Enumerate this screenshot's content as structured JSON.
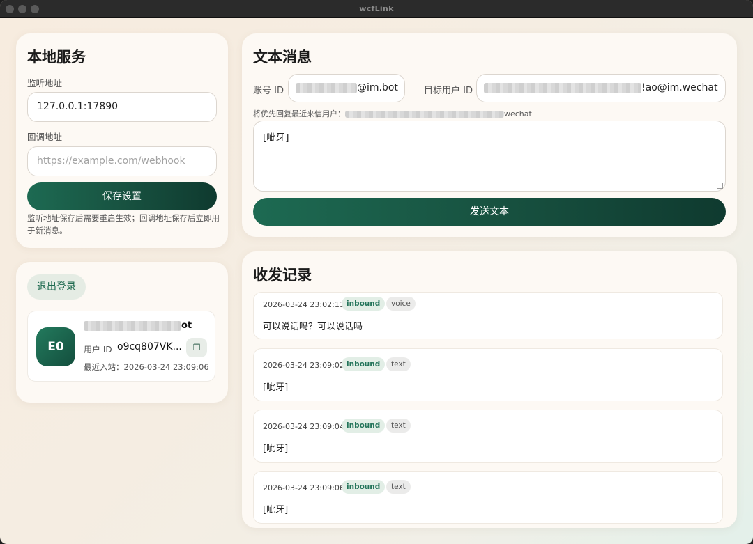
{
  "window": {
    "title": "wcfLink"
  },
  "local_service": {
    "title": "本地服务",
    "listen_label": "监听地址",
    "listen_value": "127.0.0.1:17890",
    "callback_label": "回调地址",
    "callback_placeholder": "https://example.com/webhook",
    "save_button": "保存设置",
    "note": "监听地址保存后需要重启生效；回调地址保存后立即用于新消息。"
  },
  "account": {
    "logout_button": "退出登录",
    "avatar_text": "E0",
    "name_suffix": "ot",
    "user_id_label": "用户 ID",
    "user_id_value": "o9cq807VK...",
    "last_inbound_label": "最近入站：",
    "last_inbound_value": "2026-03-24 23:09:06"
  },
  "text_message": {
    "title": "文本消息",
    "account_id_label": "账号 ID",
    "account_id_suffix": "@im.bot",
    "target_user_label": "目标用户 ID",
    "target_user_suffix": "!ao@im.wechat",
    "hint_prefix": "将优先回复最近来信用户：",
    "hint_suffix": "wechat",
    "message_value": "[呲牙]",
    "send_button": "发送文本"
  },
  "records": {
    "title": "收发记录",
    "items": [
      {
        "time": "2026-03-24 23:02:11",
        "direction": "inbound",
        "kind": "voice",
        "text": "可以说话吗？可以说话吗"
      },
      {
        "time": "2026-03-24 23:09:02",
        "direction": "inbound",
        "kind": "text",
        "text": "[呲牙]"
      },
      {
        "time": "2026-03-24 23:09:04",
        "direction": "inbound",
        "kind": "text",
        "text": "[呲牙]"
      },
      {
        "time": "2026-03-24 23:09:06",
        "direction": "inbound",
        "kind": "text",
        "text": "[呲牙]"
      }
    ]
  }
}
